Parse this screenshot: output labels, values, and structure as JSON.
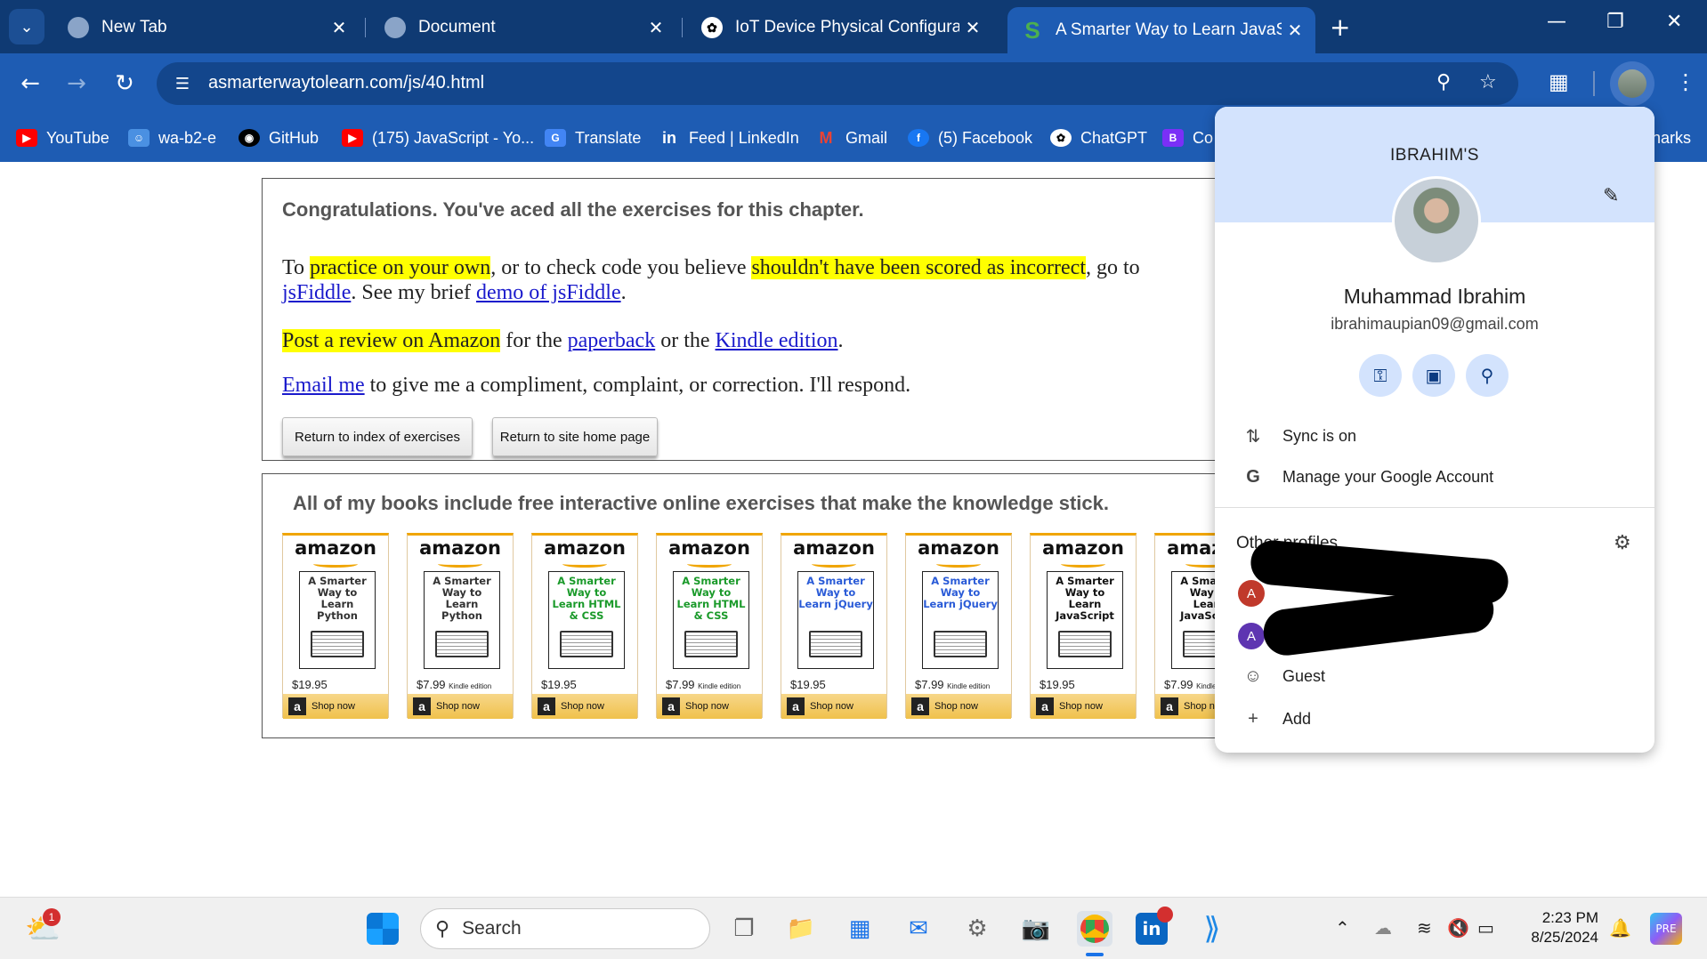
{
  "tabs": [
    {
      "title": "New Tab",
      "active": false
    },
    {
      "title": "Document",
      "active": false
    },
    {
      "title": "IoT Device Physical Configuratio",
      "active": false
    },
    {
      "title": "A Smarter Way to Learn JavaScri",
      "active": true
    }
  ],
  "address_bar": {
    "url": "asmarterwaytolearn.com/js/40.html"
  },
  "bookmarks": [
    {
      "label": "YouTube",
      "icon": "youtube-icon",
      "color": "#ff0000"
    },
    {
      "label": "wa-b2-e",
      "icon": "contact-icon",
      "color": "#4a90e2"
    },
    {
      "label": "GitHub",
      "icon": "github-icon",
      "color": "#000000"
    },
    {
      "label": "(175) JavaScript - Yo...",
      "icon": "youtube-icon",
      "color": "#ff0000"
    },
    {
      "label": "Translate",
      "icon": "translate-icon",
      "color": "#4285f4"
    },
    {
      "label": "Feed | LinkedIn",
      "icon": "linkedin-icon",
      "color": "#0a66c2"
    },
    {
      "label": "Gmail",
      "icon": "gmail-icon",
      "color": "#ea4335"
    },
    {
      "label": "(5) Facebook",
      "icon": "facebook-icon",
      "color": "#1877f2"
    },
    {
      "label": "ChatGPT",
      "icon": "chatgpt-icon",
      "color": "#ffffff"
    },
    {
      "label": "Co",
      "icon": "b-icon",
      "color": "#7b2ff7"
    },
    {
      "label": "narks",
      "icon": "none",
      "color": "#ffffff"
    }
  ],
  "page": {
    "congrats": "Congratulations. You've aced all the exercises for this chapter.",
    "p1_a": "To ",
    "p1_hl1": "practice on your own",
    "p1_b": ", or to check code you believe ",
    "p1_hl2": "shouldn't have been scored as incorrect",
    "p1_c": ", go to",
    "p1_link1": "jsFiddle",
    "p1_d": ". See my brief ",
    "p1_link2": "demo of jsFiddle",
    "p1_e": ".",
    "p2_hl": "Post a review on Amazon",
    "p2_a": " for the ",
    "p2_link1": "paperback",
    "p2_b": " or the ",
    "p2_link2": "Kindle edition",
    "p2_c": ".",
    "p3_link": "Email me",
    "p3_a": " to give me a compliment, complaint, or correction. I'll respond.",
    "btn_index": "Return to index of exercises",
    "btn_home": "Return to site home page",
    "books_heading": "All of my books include free interactive online exercises that make the knowledge stick."
  },
  "books": [
    {
      "brand": "amazon",
      "title": "A Smarter Way to Learn Python",
      "title_color": "#333333",
      "price": "$19.95",
      "edition": "",
      "shop": "Shop now"
    },
    {
      "brand": "amazon",
      "title": "A Smarter Way to Learn Python",
      "title_color": "#333333",
      "price": "$7.99",
      "edition": "Kindle edition",
      "shop": "Shop now"
    },
    {
      "brand": "amazon",
      "title": "A Smarter Way to Learn HTML & CSS",
      "title_color": "#1a9a2a",
      "price": "$19.95",
      "edition": "",
      "shop": "Shop now"
    },
    {
      "brand": "amazon",
      "title": "A Smarter Way to Learn HTML & CSS",
      "title_color": "#1a9a2a",
      "price": "$7.99",
      "edition": "Kindle edition",
      "shop": "Shop now"
    },
    {
      "brand": "amazon",
      "title": "A Smarter Way to Learn jQuery",
      "title_color": "#2a5bd7",
      "price": "$19.95",
      "edition": "",
      "shop": "Shop now"
    },
    {
      "brand": "amazon",
      "title": "A Smarter Way to Learn jQuery",
      "title_color": "#2a5bd7",
      "price": "$7.99",
      "edition": "Kindle edition",
      "shop": "Shop now"
    },
    {
      "brand": "amazon",
      "title": "A Smarter Way to Learn JavaScript",
      "title_color": "#111111",
      "price": "$19.95",
      "edition": "",
      "shop": "Shop now"
    },
    {
      "brand": "amazon",
      "title": "A Smarter Way to Learn JavaScript",
      "title_color": "#111111",
      "price": "$7.99",
      "edition": "Kindle edition",
      "shop": "Shop now"
    }
  ],
  "profile": {
    "label": "IBRAHIM'S",
    "name": "Muhammad Ibrahim",
    "email": "ibrahimaupian09@gmail.com",
    "sync": "Sync is on",
    "manage": "Manage your Google Account",
    "other_profiles": "Other profiles",
    "profile1_initial": "A",
    "profile2_initial": "A",
    "guest": "Guest",
    "add": "Add",
    "profile1_color": "#c0392b",
    "profile2_color": "#5e35b1"
  },
  "taskbar": {
    "search_placeholder": "Search",
    "weather_badge": "1",
    "time": "2:23 PM",
    "date": "8/25/2024"
  }
}
